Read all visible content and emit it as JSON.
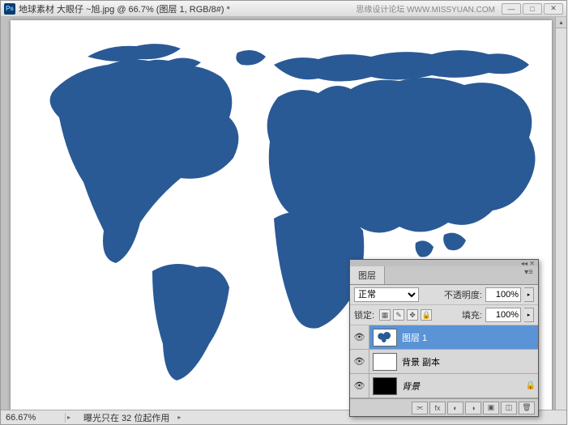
{
  "titlebar": {
    "title": "地球素材 大眼仔 ~旭.jpg @ 66.7% (图层 1, RGB/8#) *",
    "watermark": "思缘设计论坛 WWW.MISSYUAN.COM"
  },
  "statusbar": {
    "zoom": "66.67%",
    "info": "曝光只在 32 位起作用"
  },
  "layers_panel": {
    "tab": "图层",
    "blend_label": "正常",
    "opacity_label": "不透明度:",
    "opacity_value": "100%",
    "lock_label": "锁定:",
    "fill_label": "填充:",
    "fill_value": "100%",
    "layers": [
      {
        "name": "图层 1",
        "selected": true,
        "thumb": "map",
        "locked": false,
        "italic": false
      },
      {
        "name": "背景 副本",
        "selected": false,
        "thumb": "white",
        "locked": false,
        "italic": false
      },
      {
        "name": "背景",
        "selected": false,
        "thumb": "black",
        "locked": true,
        "italic": true
      }
    ]
  }
}
